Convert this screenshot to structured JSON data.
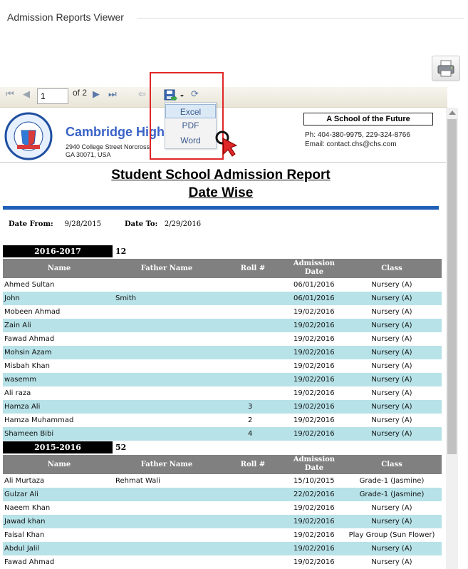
{
  "page": {
    "title": "Admission Reports Viewer"
  },
  "toolbar": {
    "page_number": "1",
    "page_of": "of 2",
    "export_menu": [
      "Excel",
      "PDF",
      "Word"
    ]
  },
  "report": {
    "school_name": "Cambridge High",
    "address_line1": "2940 College Street Norcross,",
    "address_line2": "GA 30071, USA",
    "tagline": "A School of the Future",
    "phone": "Ph: 404-380-9975, 229-324-8766",
    "email": "Email: contact.chs@chs.com",
    "logo_text": "PRAISE - EL SCHOOLS",
    "title_line1": "Student School Admission Report",
    "title_line2": "Date Wise",
    "date_from_label": "Date From:",
    "date_from": "9/28/2015",
    "date_to_label": "Date To:",
    "date_to": "2/29/2016",
    "columns": {
      "name": "Name",
      "father": "Father Name",
      "roll": "Roll #",
      "date1": "Admission",
      "date2": "Date",
      "class": "Class"
    },
    "groups": [
      {
        "session": "2016-2017",
        "count": "12",
        "rows": [
          {
            "name": "Ahmed Sultan",
            "father": "",
            "roll": "",
            "date": "06/01/2016",
            "class": "Nursery (A)"
          },
          {
            "name": "John",
            "father": "Smith",
            "roll": "",
            "date": "06/01/2016",
            "class": "Nursery (A)"
          },
          {
            "name": "Mobeen Ahmad",
            "father": "",
            "roll": "",
            "date": "19/02/2016",
            "class": "Nursery (A)"
          },
          {
            "name": "Zain Ali",
            "father": "",
            "roll": "",
            "date": "19/02/2016",
            "class": "Nursery (A)"
          },
          {
            "name": "Fawad Ahmad",
            "father": "",
            "roll": "",
            "date": "19/02/2016",
            "class": "Nursery (A)"
          },
          {
            "name": "Mohsin Azam",
            "father": "",
            "roll": "",
            "date": "19/02/2016",
            "class": "Nursery (A)"
          },
          {
            "name": "Misbah Khan",
            "father": "",
            "roll": "",
            "date": "19/02/2016",
            "class": "Nursery (A)"
          },
          {
            "name": "wasemm",
            "father": "",
            "roll": "",
            "date": "19/02/2016",
            "class": "Nursery (A)"
          },
          {
            "name": "Ali raza",
            "father": "",
            "roll": "",
            "date": "19/02/2016",
            "class": "Nursery (A)"
          },
          {
            "name": "Hamza Ali",
            "father": "",
            "roll": "3",
            "date": "19/02/2016",
            "class": "Nursery (A)"
          },
          {
            "name": "Hamza Muhammad",
            "father": "",
            "roll": "2",
            "date": "19/02/2016",
            "class": "Nursery (A)"
          },
          {
            "name": "Shameen Bibi",
            "father": "",
            "roll": "4",
            "date": "19/02/2016",
            "class": "Nursery (A)"
          }
        ]
      },
      {
        "session": "2015-2016",
        "count": "52",
        "rows": [
          {
            "name": "Ali  Murtaza",
            "father": "Rehmat Wali",
            "roll": "",
            "date": "15/10/2015",
            "class": "Grade-1 (Jasmine)"
          },
          {
            "name": "Gulzar Ali",
            "father": "",
            "roll": "",
            "date": "22/02/2016",
            "class": "Grade-1 (Jasmine)"
          },
          {
            "name": "Naeem Khan",
            "father": "",
            "roll": "",
            "date": "19/02/2016",
            "class": "Nursery (A)"
          },
          {
            "name": "Jawad khan",
            "father": "",
            "roll": "",
            "date": "19/02/2016",
            "class": "Nursery (A)"
          },
          {
            "name": "Faisal Khan",
            "father": "",
            "roll": "",
            "date": "19/02/2016",
            "class": "Play Group (Sun Flower)"
          },
          {
            "name": "Abdul Jalil",
            "father": "",
            "roll": "",
            "date": "19/02/2016",
            "class": "Nursery (A)"
          },
          {
            "name": "Fawad Ahmad",
            "father": "",
            "roll": "",
            "date": "19/02/2016",
            "class": "Nursery (A)"
          }
        ]
      }
    ]
  },
  "colors": {
    "accent_blue": "#1f5fb8",
    "row_alt": "#b7e2e8",
    "header_gray": "#808080",
    "highlight_red": "#e02626"
  }
}
